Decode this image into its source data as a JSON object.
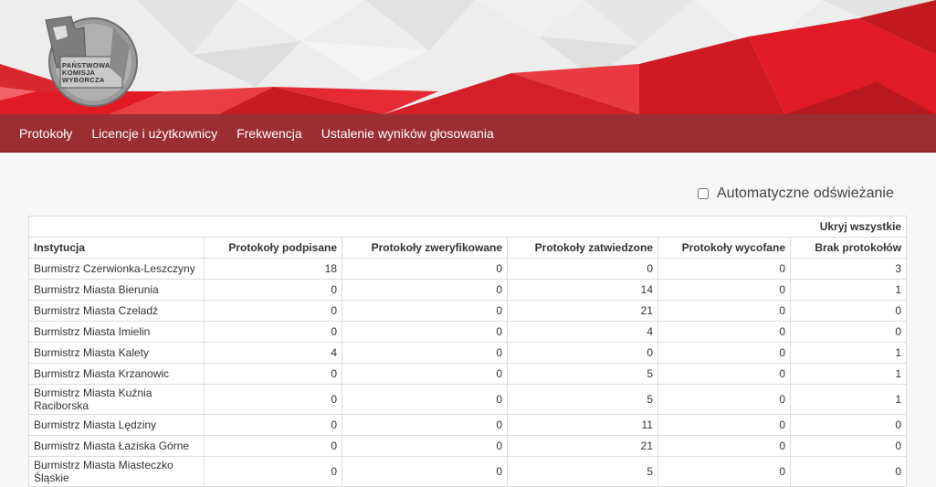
{
  "banner": {
    "logo_text": "Państwowa Komisja Wyborcza"
  },
  "nav": {
    "items": [
      {
        "label": "Protokoły",
        "name": "nav-item-protokoly"
      },
      {
        "label": "Licencje i użytkownicy",
        "name": "nav-item-licencje"
      },
      {
        "label": "Frekwencja",
        "name": "nav-item-frekwencja"
      },
      {
        "label": "Ustalenie wyników głosowania",
        "name": "nav-item-wyniki"
      }
    ]
  },
  "auto_refresh": {
    "label": "Automatyczne odświeżanie",
    "checked": false
  },
  "table": {
    "hide_all_label": "Ukryj wszystkie",
    "headers": [
      "Instytucja",
      "Protokoły podpisane",
      "Protokoły zweryfikowane",
      "Protokoły zatwiedzone",
      "Protokoły wycofane",
      "Brak protokołów"
    ],
    "rows": [
      [
        "Burmistrz Czerwionka-Leszczyny",
        "18",
        "0",
        "0",
        "0",
        "3"
      ],
      [
        "Burmistrz Miasta Bierunia",
        "0",
        "0",
        "14",
        "0",
        "1"
      ],
      [
        "Burmistrz Miasta Czeladź",
        "0",
        "0",
        "21",
        "0",
        "0"
      ],
      [
        "Burmistrz Miasta Imielin",
        "0",
        "0",
        "4",
        "0",
        "0"
      ],
      [
        "Burmistrz Miasta Kalety",
        "4",
        "0",
        "0",
        "0",
        "1"
      ],
      [
        "Burmistrz Miasta Krzanowic",
        "0",
        "0",
        "5",
        "0",
        "1"
      ],
      [
        "Burmistrz Miasta Kuźnia Raciborska",
        "0",
        "0",
        "5",
        "0",
        "1"
      ],
      [
        "Burmistrz Miasta Lędziny",
        "0",
        "0",
        "11",
        "0",
        "0"
      ],
      [
        "Burmistrz Miasta Łaziska Górne",
        "0",
        "0",
        "21",
        "0",
        "0"
      ],
      [
        "Burmistrz Miasta Miasteczko Śląskie",
        "0",
        "0",
        "5",
        "0",
        "0"
      ]
    ]
  },
  "colors": {
    "nav_bg": "#9b2e32",
    "banner_red": "#e01b25",
    "banner_grey": "#ececec"
  }
}
